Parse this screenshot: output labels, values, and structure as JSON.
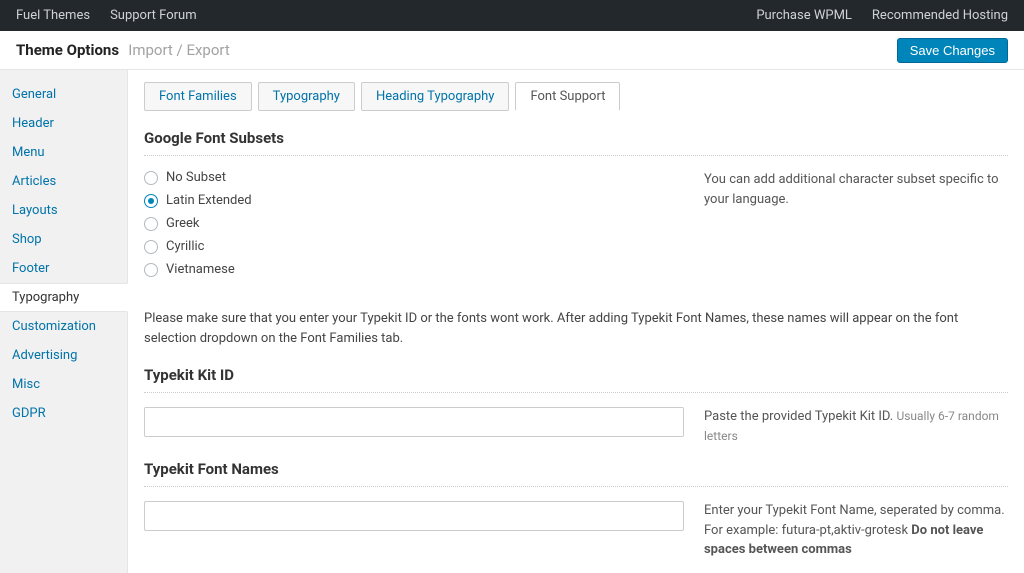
{
  "adminbar": {
    "left": [
      "Fuel Themes",
      "Support Forum"
    ],
    "right": [
      "Purchase WPML",
      "Recommended Hosting"
    ]
  },
  "header": {
    "title": "Theme Options",
    "subtitle": "Import / Export",
    "save_label": "Save Changes"
  },
  "sidebar": {
    "items": [
      {
        "label": "General"
      },
      {
        "label": "Header"
      },
      {
        "label": "Menu"
      },
      {
        "label": "Articles"
      },
      {
        "label": "Layouts"
      },
      {
        "label": "Shop"
      },
      {
        "label": "Footer"
      },
      {
        "label": "Typography",
        "active": true
      },
      {
        "label": "Customization"
      },
      {
        "label": "Advertising"
      },
      {
        "label": "Misc"
      },
      {
        "label": "GDPR"
      }
    ]
  },
  "tabs": [
    {
      "label": "Font Families"
    },
    {
      "label": "Typography"
    },
    {
      "label": "Heading Typography"
    },
    {
      "label": "Font Support",
      "active": true
    }
  ],
  "section_subsets": {
    "title": "Google Font Subsets",
    "help": "You can add additional character subset specific to your language.",
    "options": [
      {
        "label": "No Subset",
        "checked": false
      },
      {
        "label": "Latin Extended",
        "checked": true
      },
      {
        "label": "Greek",
        "checked": false
      },
      {
        "label": "Cyrillic",
        "checked": false
      },
      {
        "label": "Vietnamese",
        "checked": false
      }
    ]
  },
  "typekit_note": "Please make sure that you enter your Typekit ID or the fonts wont work. After adding Typekit Font Names, these names will appear on the font selection dropdown on the Font Families tab.",
  "section_kit_id": {
    "title": "Typekit Kit ID",
    "value": "",
    "help_main": "Paste the provided Typekit Kit ID. ",
    "help_muted": "Usually 6-7 random letters"
  },
  "section_font_names": {
    "title": "Typekit Font Names",
    "value": "",
    "help_pre": "Enter your Typekit Font Name, seperated by comma. For example: futura-pt,aktiv-grotesk ",
    "help_bold": "Do not leave spaces between commas"
  }
}
